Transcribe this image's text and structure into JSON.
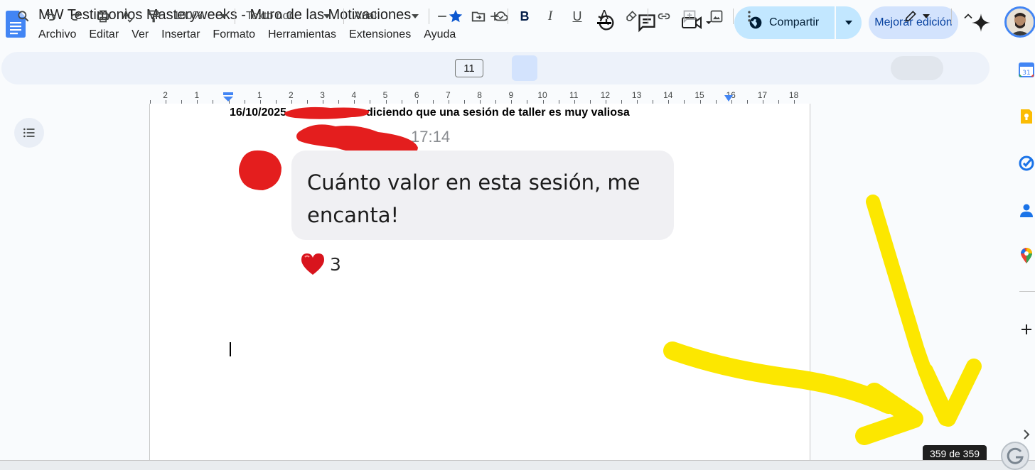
{
  "app": {
    "title": "MW Testimonios Masteryweeks - Muro de las Motivaciones",
    "menu": [
      "Archivo",
      "Editar",
      "Ver",
      "Insertar",
      "Formato",
      "Herramientas",
      "Extensiones",
      "Ayuda"
    ],
    "share_label": "Compartir",
    "improve_label": "Mejorar edición"
  },
  "toolbar": {
    "zoom": "100%",
    "style": "Texto nor...",
    "font": "Arial",
    "font_size": "11",
    "bold": "B",
    "italic": "I",
    "underline": "U",
    "text_color": "A"
  },
  "ruler": {
    "numbers": [
      "2",
      "1",
      "1",
      "2",
      "3",
      "4",
      "5",
      "6",
      "7",
      "8",
      "9",
      "10",
      "11",
      "12",
      "13",
      "14",
      "15",
      "16",
      "17",
      "18"
    ]
  },
  "document": {
    "heading_pre": "16/10/2025",
    "heading_post": "diciendo que una sesión de taller es muy valiosa",
    "time": "17:14",
    "message": "Cuánto valor en esta sesión, me encanta!",
    "reaction_count": "3"
  },
  "status": {
    "page_count": "359 de 359"
  },
  "colors": {
    "accent": "#0b57d0",
    "share_bg": "#c2e7ff",
    "redaction": "#e41e1e",
    "annotation": "#fce700"
  },
  "icons": {
    "star": "star-icon",
    "move": "move-to-folder-icon",
    "cloud": "cloud-saved-icon",
    "history": "history-icon",
    "comments": "comments-icon",
    "meet": "meet-icon",
    "globe": "globe-icon",
    "gemini": "gemini-icon"
  }
}
